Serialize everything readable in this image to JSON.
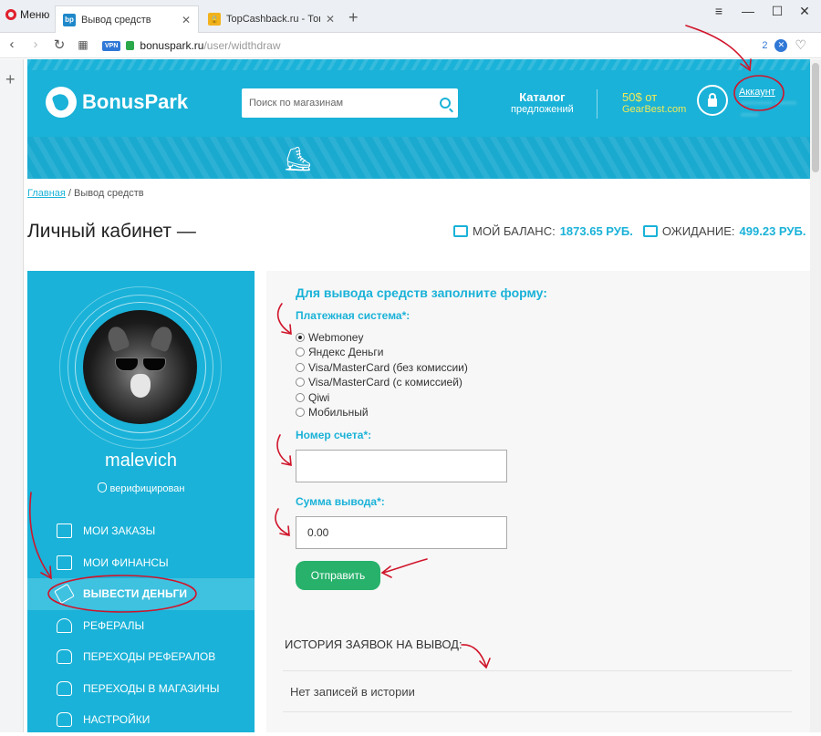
{
  "browser": {
    "menu_label": "Меню",
    "tabs": [
      {
        "label": "Вывод средств",
        "favicon": "bp",
        "active": true
      },
      {
        "label": "TopCashback.ru - Топ лучш",
        "favicon": "lock",
        "active": false
      }
    ],
    "url_host": "bonuspark.ru",
    "url_path": "/user/widthdraw",
    "vpn_label": "VPN",
    "shield_count": "2"
  },
  "header": {
    "logo_text": "BonusPark",
    "search_placeholder": "Поиск по магазинам",
    "catalog_line1": "Каталог",
    "catalog_line2": "предложений",
    "promo_line1": "50$ от",
    "promo_line2": "GearBest.com",
    "account_label": "Аккаунт",
    "account_blurred": "********* ****** *****"
  },
  "breadcrumb": {
    "home": "Главная",
    "separator": " / ",
    "current": "Вывод средств"
  },
  "page_title": "Личный кабинет —",
  "balance": {
    "balance_label": "МОЙ БАЛАНС:",
    "balance_value": "1873.65 РУБ.",
    "pending_label": "ОЖИДАНИЕ:",
    "pending_value": "499.23 РУБ."
  },
  "profile": {
    "username": "malevich",
    "status": "верифицирован",
    "menu": [
      {
        "label": "МОИ ЗАКАЗЫ",
        "icon": "bag-icon"
      },
      {
        "label": "МОИ ФИНАНСЫ",
        "icon": "book-icon"
      },
      {
        "label": "ВЫВЕСТИ ДЕНЬГИ",
        "icon": "money-icon",
        "active": true
      },
      {
        "label": "РЕФЕРАЛЫ",
        "icon": "referral-icon"
      },
      {
        "label": "ПЕРЕХОДЫ РЕФЕРАЛОВ",
        "icon": "hand-pointer-icon"
      },
      {
        "label": "ПЕРЕХОДЫ В МАГАЗИНЫ",
        "icon": "hand-pointer-icon"
      },
      {
        "label": "НАСТРОЙКИ",
        "icon": "hand-pointer-icon"
      }
    ]
  },
  "form": {
    "title": "Для вывода средств заполните форму:",
    "payment_label": "Платежная система*:",
    "payment_options": [
      "Webmoney",
      "Яндекс Деньги",
      "Visa/MasterCard (без комиссии)",
      "Visa/MasterCard (с комиссией)",
      "Qiwi",
      "Мобильный"
    ],
    "selected_option": "Webmoney",
    "account_label": "Номер счета*:",
    "account_value": "",
    "amount_label": "Сумма вывода*:",
    "amount_value": "0.00",
    "submit_label": "Отправить"
  },
  "history": {
    "title": "ИСТОРИЯ ЗАЯВОК НА ВЫВОД:",
    "empty_text": "Нет записей в истории"
  },
  "colors": {
    "brand": "#1ab2d8",
    "submit": "#27b16b",
    "promo": "#f3ea57",
    "annotation": "#d0152b"
  }
}
